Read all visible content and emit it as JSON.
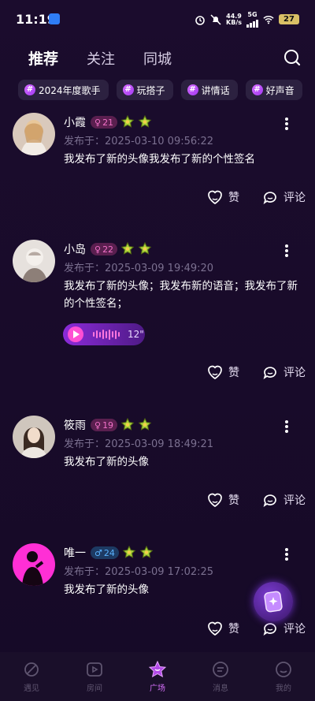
{
  "status_bar": {
    "time": "11:19",
    "net_speed_value": "44.9",
    "net_speed_unit": "KB/s",
    "network": "5G",
    "battery": "27"
  },
  "top_tabs": [
    {
      "label": "推荐",
      "active": true
    },
    {
      "label": "关注",
      "active": false
    },
    {
      "label": "同城",
      "active": false
    }
  ],
  "topics": [
    {
      "label": "2024年度歌手"
    },
    {
      "label": "玩搭子"
    },
    {
      "label": "讲情话"
    },
    {
      "label": "好声音"
    }
  ],
  "posts": [
    {
      "name": "小霞",
      "gender": "female",
      "age": "21",
      "time_label": "发布于：2025-03-10 09:56:22",
      "text": "我发布了新的头像我发布了新的个性签名",
      "like_label": "赞",
      "comment_label": "评论"
    },
    {
      "name": "小岛",
      "gender": "female",
      "age": "22",
      "time_label": "发布于：2025-03-09 19:49:20",
      "text": "我发布了新的头像；我发布新的语音；我发布了新的个性签名；",
      "voice_duration": "12\"",
      "like_label": "赞",
      "comment_label": "评论"
    },
    {
      "name": "筱雨",
      "gender": "female",
      "age": "19",
      "time_label": "发布于：2025-03-09 18:49:21",
      "text": "我发布了新的头像",
      "like_label": "赞",
      "comment_label": "评论"
    },
    {
      "name": "唯一",
      "gender": "male",
      "age": "24",
      "time_label": "发布于：2025-03-09 17:02:25",
      "text": "我发布了新的头像",
      "like_label": "赞",
      "comment_label": "评论"
    }
  ],
  "bottom_nav": [
    {
      "label": "遇见",
      "icon": "planet-icon",
      "active": false
    },
    {
      "label": "房间",
      "icon": "play-icon",
      "active": false
    },
    {
      "label": "广场",
      "icon": "star-icon",
      "active": true
    },
    {
      "label": "消息",
      "icon": "message-icon",
      "active": false
    },
    {
      "label": "我的",
      "icon": "smile-icon",
      "active": false
    }
  ],
  "colors": {
    "background": "#1b0c2d",
    "accent": "#d36ef7",
    "female_badge": "#f171c8",
    "male_badge": "#5ab2ff"
  }
}
